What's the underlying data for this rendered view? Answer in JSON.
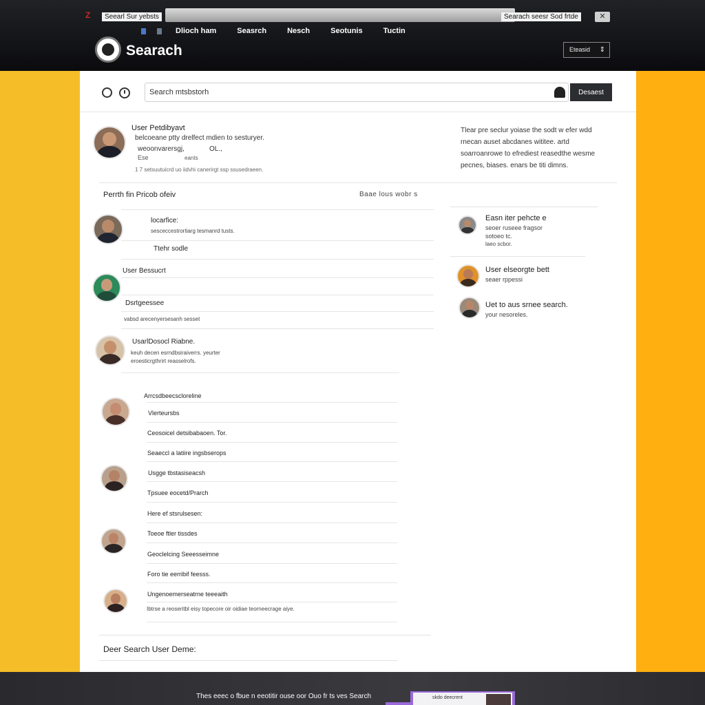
{
  "browser": {
    "left_tab": "Seearl Sur yebsts",
    "right_tab": "Searach seesr Sod frtde",
    "close_icon": "✕",
    "brand_glyph": "Z"
  },
  "nav": {
    "items": [
      "Dlioch ham",
      "Seasrch",
      "Nesch",
      "Seotunis",
      "Tuctin"
    ]
  },
  "header": {
    "brand": "Searach",
    "button_label": "Eteasid",
    "button_caret": "⇕"
  },
  "search": {
    "placeholder": "Search mtsbstorh",
    "button_label": "Desaest"
  },
  "profile": {
    "name": "User Petdibyavt",
    "description": "belcoeane ptty drelfect mdien to sesturyer.",
    "meta1": "weoonvarersgj,",
    "meta1b": "OL.,",
    "meta2": "Ese",
    "meta2b": "eants",
    "footer": "1 7 setsuutuicrd uo iidvhi canerirgt ssp ssusedraeen.",
    "intro": "Tlear pre seclur yoiase the sodt w efer wdd rnecan auset abcdanes wititee. artd soarroanrowe to efrediest reasedthe wesme pecnes, biases. enars be titi dimns."
  },
  "results": {
    "title": "Perrth fin Pricob ofeiv",
    "action": "Baae  lous wobr s",
    "rows": [
      {
        "title": "locarfice:",
        "sub": "sesceccestrortiarg tesmanrd tusts."
      },
      {
        "title": "Ttehr sodle",
        "sub": ""
      },
      {
        "title": "User Bessucrt",
        "sub": ""
      },
      {
        "title": "Dsrtgeessee",
        "sub": ""
      },
      {
        "title": "",
        "sub": "vabsd arecenyersesanh sesset"
      },
      {
        "title": "UsarlDosocl Riabne.",
        "sub": "keuh decen esrndbsiraiverrs. yeurter eroesticrgthrirt reasselrofs."
      },
      {
        "title": "Arrcsdbeecscloreline",
        "sub": ""
      },
      {
        "title": "Vlerteursbs",
        "sub": ""
      },
      {
        "title": "Ceosoicel detsibabaoen. Tor.",
        "sub": ""
      },
      {
        "title": "Seaeccl a latiire ingsbserops",
        "sub": ""
      },
      {
        "title": "Usgge tbstasiseacsh",
        "sub": ""
      },
      {
        "title": "Tpsuee eocetd/Prarch",
        "sub": ""
      },
      {
        "title": "Here ef stsrulsesen:",
        "sub": ""
      },
      {
        "title": "Toeoe ftler tissdes",
        "sub": ""
      },
      {
        "title": "Geoclelcing Seeesseimne",
        "sub": ""
      },
      {
        "title": "Foro tie eerribif feesss.",
        "sub": ""
      },
      {
        "title": "Ungenoemerseatrne teeeaith",
        "sub": "Ibtrse a reoseritbl eisy topecore oir oidiae teorneecrage aiye."
      }
    ],
    "footer_title": "Deer Search User Deme:"
  },
  "suggestions": [
    {
      "name": "Easn iter pehcte e",
      "sub1": "seoer ruseee fragsor",
      "sub2": "sotoeo tc.",
      "sub3": "laeo scbor."
    },
    {
      "name": "User elseorgte bett",
      "sub1": "seaer rppessi",
      "sub2": "",
      "sub3": ""
    },
    {
      "name": "Uet to aus srnee search.",
      "sub1": "your nesoreles.",
      "sub2": "",
      "sub3": ""
    }
  ],
  "bottom": {
    "text": "Thes eeec o fbue n eeotitir ouse oor Ouo fr ts ves Search",
    "thumb_label": "skdo deecrent"
  },
  "colors": {
    "accent_yellow_left": "#f5bd28",
    "accent_yellow_right": "#ffaf0f",
    "header_dark": "#0b0b0e",
    "button_dark": "#2b2d31",
    "purple": "#9a6ad9"
  },
  "icons": {
    "search": "search-icon",
    "history": "clock-icon",
    "voice": "microphone-icon"
  }
}
